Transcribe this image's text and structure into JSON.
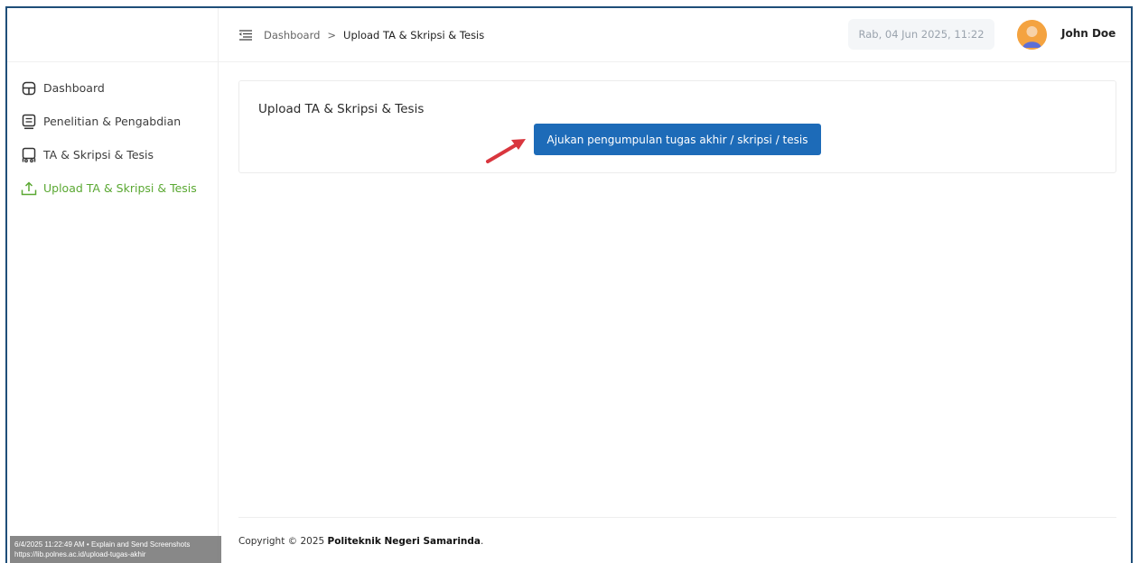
{
  "sidebar": {
    "items": [
      {
        "label": "Dashboard",
        "icon": "dashboard-icon",
        "active": false
      },
      {
        "label": "Penelitian & Pengabdian",
        "icon": "document-icon",
        "active": false
      },
      {
        "label": "TA & Skripsi & Tesis",
        "icon": "book-icon",
        "active": false
      },
      {
        "label": "Upload TA & Skripsi & Tesis",
        "icon": "upload-icon",
        "active": true
      }
    ],
    "active_color": "#5aa832"
  },
  "header": {
    "breadcrumb": {
      "root": "Dashboard",
      "separator": ">",
      "current": "Upload TA & Skripsi & Tesis"
    },
    "datetime": "Rab, 04 Jun 2025, 11:22",
    "user_name": "John Doe"
  },
  "main": {
    "card_title": "Upload TA & Skripsi & Tesis",
    "submit_button_label": "Ajukan pengumpulan tugas akhir / skripsi / tesis",
    "button_color": "#1d6bb8",
    "annotation_arrow_color": "#d9363e"
  },
  "footer": {
    "copyright_prefix": "Copyright © 2025",
    "organization": "Politeknik Negeri Samarinda",
    "suffix": "."
  },
  "overlay": {
    "line1": "6/4/2025 11:22:49 AM • Explain and Send Screenshots",
    "line2": "https://lib.polnes.ac.id/upload-tugas-akhir"
  }
}
